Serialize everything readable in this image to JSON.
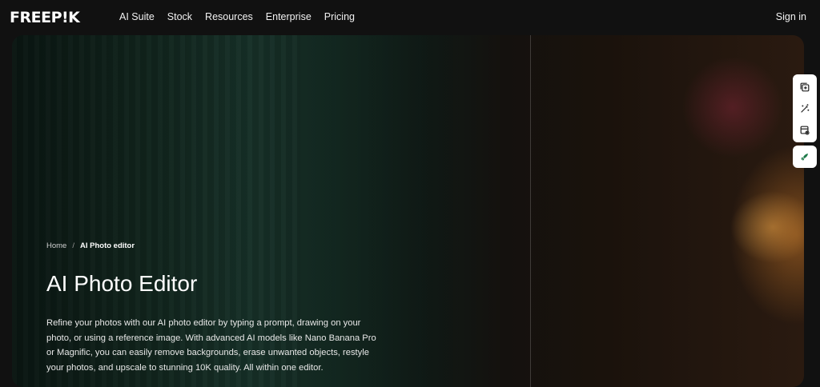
{
  "header": {
    "logo": "FREEP!K",
    "nav": [
      {
        "label": "AI Suite"
      },
      {
        "label": "Stock"
      },
      {
        "label": "Resources"
      },
      {
        "label": "Enterprise"
      },
      {
        "label": "Pricing"
      }
    ],
    "signin_label": "Sign in"
  },
  "hero": {
    "breadcrumb": {
      "home": "Home",
      "separator": "/",
      "current": "AI Photo editor"
    },
    "title": "AI Photo Editor",
    "description": "Refine your photos with our AI photo editor by typing a prompt, drawing on your photo, or using a reference image. With advanced AI models like Nano Banana Pro or Magnific, you can easily remove backgrounds, erase unwanted objects, restyle your photos, and upscale to stunning 10K quality. All within one editor."
  },
  "side_tools": {
    "icons": [
      "copy-plus-icon",
      "magic-wand-icon",
      "image-settings-icon",
      "rocket-icon"
    ],
    "accent_color": "#1f7a4a"
  }
}
